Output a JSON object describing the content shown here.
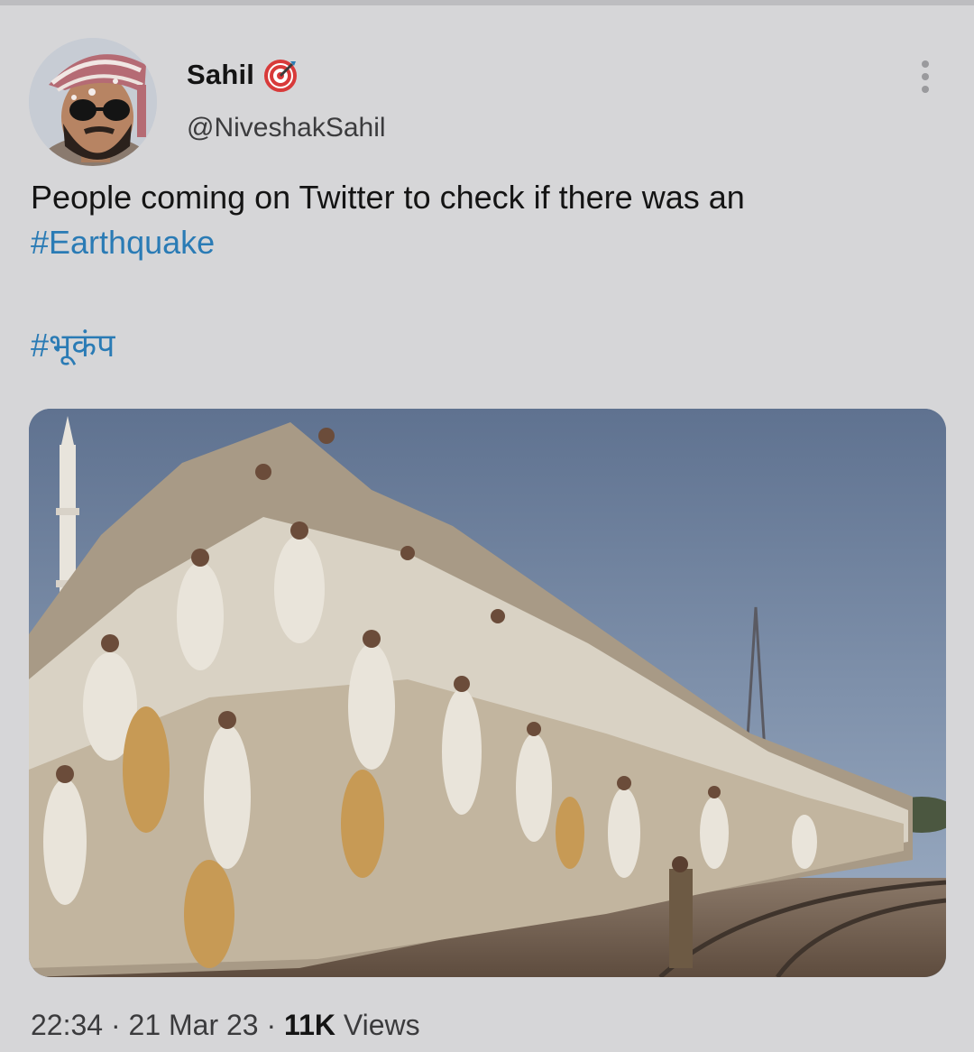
{
  "author": {
    "display_name": "Sahil",
    "handle": "@NiveshakSahil",
    "badge_icon": "target-icon"
  },
  "menu": {
    "icon": "more-vertical-icon"
  },
  "tweet": {
    "text_line1": "People coming on Twitter to check if there was an",
    "hashtag_1": "#Earthquake",
    "hashtag_2": "#भूकंप"
  },
  "meta": {
    "time": "22:34",
    "sep1": " · ",
    "date": "21 Mar 23",
    "sep2": " · ",
    "views_count": "11K",
    "views_label": " Views"
  },
  "colors": {
    "background": "#d6d6d8",
    "link": "#2a7bb5",
    "text": "#141414",
    "secondary": "#3b3b3d"
  }
}
